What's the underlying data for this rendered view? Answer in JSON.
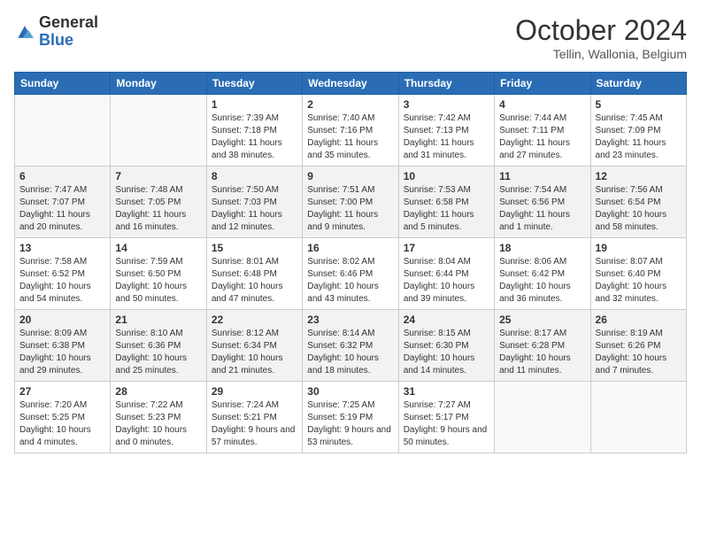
{
  "logo": {
    "general": "General",
    "blue": "Blue"
  },
  "title": "October 2024",
  "location": "Tellin, Wallonia, Belgium",
  "days_of_week": [
    "Sunday",
    "Monday",
    "Tuesday",
    "Wednesday",
    "Thursday",
    "Friday",
    "Saturday"
  ],
  "weeks": [
    [
      {
        "day": "",
        "info": ""
      },
      {
        "day": "",
        "info": ""
      },
      {
        "day": "1",
        "info": "Sunrise: 7:39 AM\nSunset: 7:18 PM\nDaylight: 11 hours and 38 minutes."
      },
      {
        "day": "2",
        "info": "Sunrise: 7:40 AM\nSunset: 7:16 PM\nDaylight: 11 hours and 35 minutes."
      },
      {
        "day": "3",
        "info": "Sunrise: 7:42 AM\nSunset: 7:13 PM\nDaylight: 11 hours and 31 minutes."
      },
      {
        "day": "4",
        "info": "Sunrise: 7:44 AM\nSunset: 7:11 PM\nDaylight: 11 hours and 27 minutes."
      },
      {
        "day": "5",
        "info": "Sunrise: 7:45 AM\nSunset: 7:09 PM\nDaylight: 11 hours and 23 minutes."
      }
    ],
    [
      {
        "day": "6",
        "info": "Sunrise: 7:47 AM\nSunset: 7:07 PM\nDaylight: 11 hours and 20 minutes."
      },
      {
        "day": "7",
        "info": "Sunrise: 7:48 AM\nSunset: 7:05 PM\nDaylight: 11 hours and 16 minutes."
      },
      {
        "day": "8",
        "info": "Sunrise: 7:50 AM\nSunset: 7:03 PM\nDaylight: 11 hours and 12 minutes."
      },
      {
        "day": "9",
        "info": "Sunrise: 7:51 AM\nSunset: 7:00 PM\nDaylight: 11 hours and 9 minutes."
      },
      {
        "day": "10",
        "info": "Sunrise: 7:53 AM\nSunset: 6:58 PM\nDaylight: 11 hours and 5 minutes."
      },
      {
        "day": "11",
        "info": "Sunrise: 7:54 AM\nSunset: 6:56 PM\nDaylight: 11 hours and 1 minute."
      },
      {
        "day": "12",
        "info": "Sunrise: 7:56 AM\nSunset: 6:54 PM\nDaylight: 10 hours and 58 minutes."
      }
    ],
    [
      {
        "day": "13",
        "info": "Sunrise: 7:58 AM\nSunset: 6:52 PM\nDaylight: 10 hours and 54 minutes."
      },
      {
        "day": "14",
        "info": "Sunrise: 7:59 AM\nSunset: 6:50 PM\nDaylight: 10 hours and 50 minutes."
      },
      {
        "day": "15",
        "info": "Sunrise: 8:01 AM\nSunset: 6:48 PM\nDaylight: 10 hours and 47 minutes."
      },
      {
        "day": "16",
        "info": "Sunrise: 8:02 AM\nSunset: 6:46 PM\nDaylight: 10 hours and 43 minutes."
      },
      {
        "day": "17",
        "info": "Sunrise: 8:04 AM\nSunset: 6:44 PM\nDaylight: 10 hours and 39 minutes."
      },
      {
        "day": "18",
        "info": "Sunrise: 8:06 AM\nSunset: 6:42 PM\nDaylight: 10 hours and 36 minutes."
      },
      {
        "day": "19",
        "info": "Sunrise: 8:07 AM\nSunset: 6:40 PM\nDaylight: 10 hours and 32 minutes."
      }
    ],
    [
      {
        "day": "20",
        "info": "Sunrise: 8:09 AM\nSunset: 6:38 PM\nDaylight: 10 hours and 29 minutes."
      },
      {
        "day": "21",
        "info": "Sunrise: 8:10 AM\nSunset: 6:36 PM\nDaylight: 10 hours and 25 minutes."
      },
      {
        "day": "22",
        "info": "Sunrise: 8:12 AM\nSunset: 6:34 PM\nDaylight: 10 hours and 21 minutes."
      },
      {
        "day": "23",
        "info": "Sunrise: 8:14 AM\nSunset: 6:32 PM\nDaylight: 10 hours and 18 minutes."
      },
      {
        "day": "24",
        "info": "Sunrise: 8:15 AM\nSunset: 6:30 PM\nDaylight: 10 hours and 14 minutes."
      },
      {
        "day": "25",
        "info": "Sunrise: 8:17 AM\nSunset: 6:28 PM\nDaylight: 10 hours and 11 minutes."
      },
      {
        "day": "26",
        "info": "Sunrise: 8:19 AM\nSunset: 6:26 PM\nDaylight: 10 hours and 7 minutes."
      }
    ],
    [
      {
        "day": "27",
        "info": "Sunrise: 7:20 AM\nSunset: 5:25 PM\nDaylight: 10 hours and 4 minutes."
      },
      {
        "day": "28",
        "info": "Sunrise: 7:22 AM\nSunset: 5:23 PM\nDaylight: 10 hours and 0 minutes."
      },
      {
        "day": "29",
        "info": "Sunrise: 7:24 AM\nSunset: 5:21 PM\nDaylight: 9 hours and 57 minutes."
      },
      {
        "day": "30",
        "info": "Sunrise: 7:25 AM\nSunset: 5:19 PM\nDaylight: 9 hours and 53 minutes."
      },
      {
        "day": "31",
        "info": "Sunrise: 7:27 AM\nSunset: 5:17 PM\nDaylight: 9 hours and 50 minutes."
      },
      {
        "day": "",
        "info": ""
      },
      {
        "day": "",
        "info": ""
      }
    ]
  ]
}
